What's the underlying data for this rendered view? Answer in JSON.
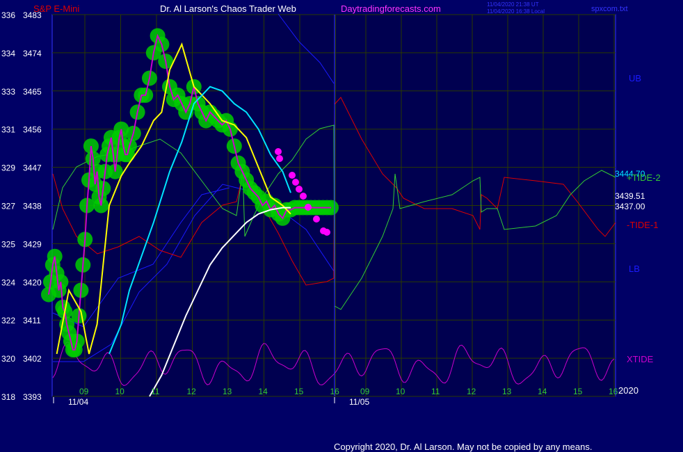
{
  "header": {
    "symbol": "S&P E-Mini",
    "title": "Dr. Al Larson's Chaos Trader Web",
    "site": "Daytradingforecasts.com",
    "stamp1": "11/04/2020 21:38 UT",
    "stamp2": "11/04/2020 16:38 Local",
    "file": "spxcom.txt"
  },
  "footer": {
    "copyright": "Copyright 2020, Dr. Al Larson. May not be copied by any means."
  },
  "colors": {
    "background": "#000066",
    "plot_bg": "#000050",
    "grid": "#2a3a00",
    "axis_text": "#ffffff",
    "price_dots": "#00cc00",
    "bar_trace": "#cc00cc",
    "yellow_ma": "#ffff00",
    "cyan_ma": "#00e5ff",
    "white_ma": "#ffffff",
    "band": "#1a1aff",
    "tide1": "#dd0000",
    "tide2": "#33cc33",
    "xtide": "#cc00cc",
    "magenta_dots": "#ff00ff",
    "time_labels": "#33cc33",
    "date_labels": "#ffffff",
    "header_symbol": "#dd0000",
    "header_site": "#ff33ff",
    "header_stamp": "#3333ff",
    "ub_lb": "#1a1aff"
  },
  "chart_data": {
    "type": "line",
    "title": "S&P E-Mini",
    "xlabel": "",
    "ylabel": "",
    "ylim": [
      3393,
      3483
    ],
    "grid": true,
    "y_axis_labels": [
      {
        "left": "336",
        "right": "3483"
      },
      {
        "left": "334",
        "right": "3474"
      },
      {
        "left": "333",
        "right": "3465"
      },
      {
        "left": "331",
        "right": "3456"
      },
      {
        "left": "329",
        "right": "3447"
      },
      {
        "left": "327",
        "right": "3438"
      },
      {
        "left": "325",
        "right": "3429"
      },
      {
        "left": "324",
        "right": "3420"
      },
      {
        "left": "322",
        "right": "3411"
      },
      {
        "left": "320",
        "right": "3402"
      },
      {
        "left": "318",
        "right": "3393"
      }
    ],
    "x_tick_labels": [
      "09",
      "10",
      "11",
      "12",
      "13",
      "14",
      "15",
      "16",
      "09",
      "10",
      "11",
      "12",
      "13",
      "14",
      "15",
      "16"
    ],
    "date_labels": [
      "11/04",
      "11/05"
    ],
    "right_year": "2020",
    "separator_time": "16 (11/04)",
    "right_labels": {
      "ub": "UB",
      "lb": "LB",
      "tide2": "+TIDE-2",
      "tide1": "-TIDE-1",
      "xtide": "XTIDE",
      "v1": "3444.70",
      "v2": "3439.51",
      "v3": "3437.00"
    },
    "series": [
      {
        "name": "price",
        "x": [
          0,
          0.05,
          0.1,
          0.15,
          0.2,
          0.25,
          0.3,
          0.35,
          0.4,
          0.45,
          0.5,
          0.55,
          0.6,
          0.65,
          0.7,
          0.75,
          0.8,
          0.85,
          0.9,
          0.95,
          1.0,
          1.05,
          1.1,
          1.15,
          1.2,
          1.25,
          1.3,
          1.35,
          1.4,
          1.45,
          1.5,
          1.55,
          1.6,
          1.65,
          1.7,
          1.75,
          1.8,
          1.85,
          1.9,
          1.95,
          2.0,
          2.1,
          2.2,
          2.3,
          2.4,
          2.5,
          2.6,
          2.7,
          2.8,
          2.9,
          3.0,
          3.1,
          3.2,
          3.3,
          3.4,
          3.5,
          3.6,
          3.7,
          3.8,
          3.9,
          4.0,
          4.1,
          4.2,
          4.3,
          4.4,
          4.5,
          4.6,
          4.7,
          4.8,
          4.9,
          5.0,
          5.1,
          5.2,
          5.3,
          5.4,
          5.5,
          5.6,
          5.7,
          5.8,
          5.9,
          6.0,
          6.1,
          6.2,
          6.3,
          6.4,
          6.5,
          6.6,
          6.7,
          6.8,
          6.9,
          7.0
        ],
        "values": [
          3417,
          3420,
          3424,
          3426,
          3422,
          3418,
          3420,
          3414,
          3413,
          3410,
          3408,
          3406,
          3404,
          3404,
          3406,
          3412,
          3418,
          3424,
          3430,
          3438,
          3444,
          3452,
          3449,
          3443,
          3446,
          3440,
          3438,
          3442,
          3446,
          3450,
          3452,
          3454,
          3450,
          3446,
          3450,
          3454,
          3456,
          3452,
          3450,
          3450,
          3452,
          3455,
          3460,
          3464,
          3464,
          3468,
          3474,
          3478,
          3476,
          3472,
          3466,
          3463,
          3464,
          3462,
          3460,
          3462,
          3466,
          3462,
          3460,
          3458,
          3460,
          3459,
          3458,
          3457,
          3458,
          3456,
          3452,
          3448,
          3446,
          3444,
          3442,
          3441,
          3440,
          3438,
          3439,
          3437,
          3438,
          3436,
          3435,
          3437,
          3437,
          3437.5,
          3437.5,
          3437.5,
          3437.5,
          3437.5,
          3437.5,
          3437.5,
          3437.5,
          3437.5,
          3437.5
        ]
      },
      {
        "name": "yellow",
        "x": [
          0.2,
          0.5,
          0.8,
          1.0,
          1.2,
          1.5,
          1.8,
          2.0,
          2.3,
          2.6,
          2.8,
          3.0,
          3.3,
          3.6,
          4.0,
          4.3,
          4.6,
          4.9,
          5.2,
          5.5,
          5.8,
          6.0
        ],
        "values": [
          3403,
          3418,
          3413,
          3403,
          3410,
          3438,
          3445,
          3448,
          3452,
          3458,
          3460,
          3470,
          3476,
          3466,
          3462,
          3458,
          3457,
          3454,
          3447,
          3440,
          3438,
          3436
        ]
      },
      {
        "name": "cyan",
        "x": [
          1.5,
          1.8,
          2.0,
          2.3,
          2.6,
          2.8,
          3.0,
          3.3,
          3.6,
          4.0,
          4.3,
          4.6,
          4.9,
          5.2,
          5.5,
          5.8,
          6.0
        ],
        "values": [
          3403,
          3410,
          3418,
          3426,
          3434,
          3440,
          3446,
          3453,
          3462,
          3466,
          3465,
          3462,
          3460,
          3456,
          3450,
          3446,
          3441
        ]
      },
      {
        "name": "white",
        "x": [
          2.5,
          2.8,
          3.1,
          3.4,
          3.7,
          4.0,
          4.3,
          4.6,
          4.9,
          5.2,
          5.5,
          5.8,
          6.0
        ],
        "values": [
          3393,
          3398,
          3405,
          3412,
          3418,
          3424,
          3428,
          3431,
          3434,
          3436,
          3437,
          3437.5,
          3437.5
        ]
      }
    ]
  }
}
